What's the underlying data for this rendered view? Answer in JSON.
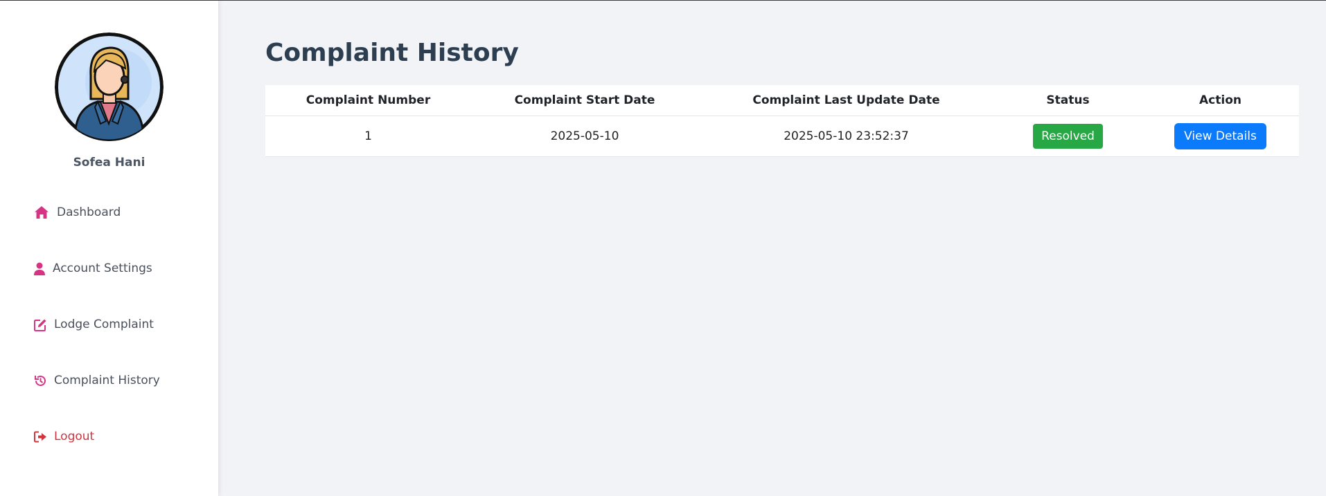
{
  "sidebar": {
    "user_name": "Sofea Hani",
    "items": [
      {
        "label": "Dashboard",
        "icon": "home-icon"
      },
      {
        "label": "Account Settings",
        "icon": "user-icon"
      },
      {
        "label": "Lodge Complaint",
        "icon": "edit-icon"
      },
      {
        "label": "Complaint History",
        "icon": "history-icon"
      },
      {
        "label": "Logout",
        "icon": "logout-icon"
      }
    ],
    "icon_color": "#d63384",
    "logout_color": "#d0343f"
  },
  "main": {
    "title": "Complaint History",
    "table": {
      "headers": [
        "Complaint Number",
        "Complaint Start Date",
        "Complaint Last Update Date",
        "Status",
        "Action"
      ],
      "rows": [
        {
          "number": "1",
          "start_date": "2025-05-10",
          "last_update": "2025-05-10 23:52:37",
          "status": "Resolved",
          "action": "View Details"
        }
      ]
    },
    "colors": {
      "status_resolved": "#28a745",
      "action_button": "#0b7bfc"
    }
  }
}
